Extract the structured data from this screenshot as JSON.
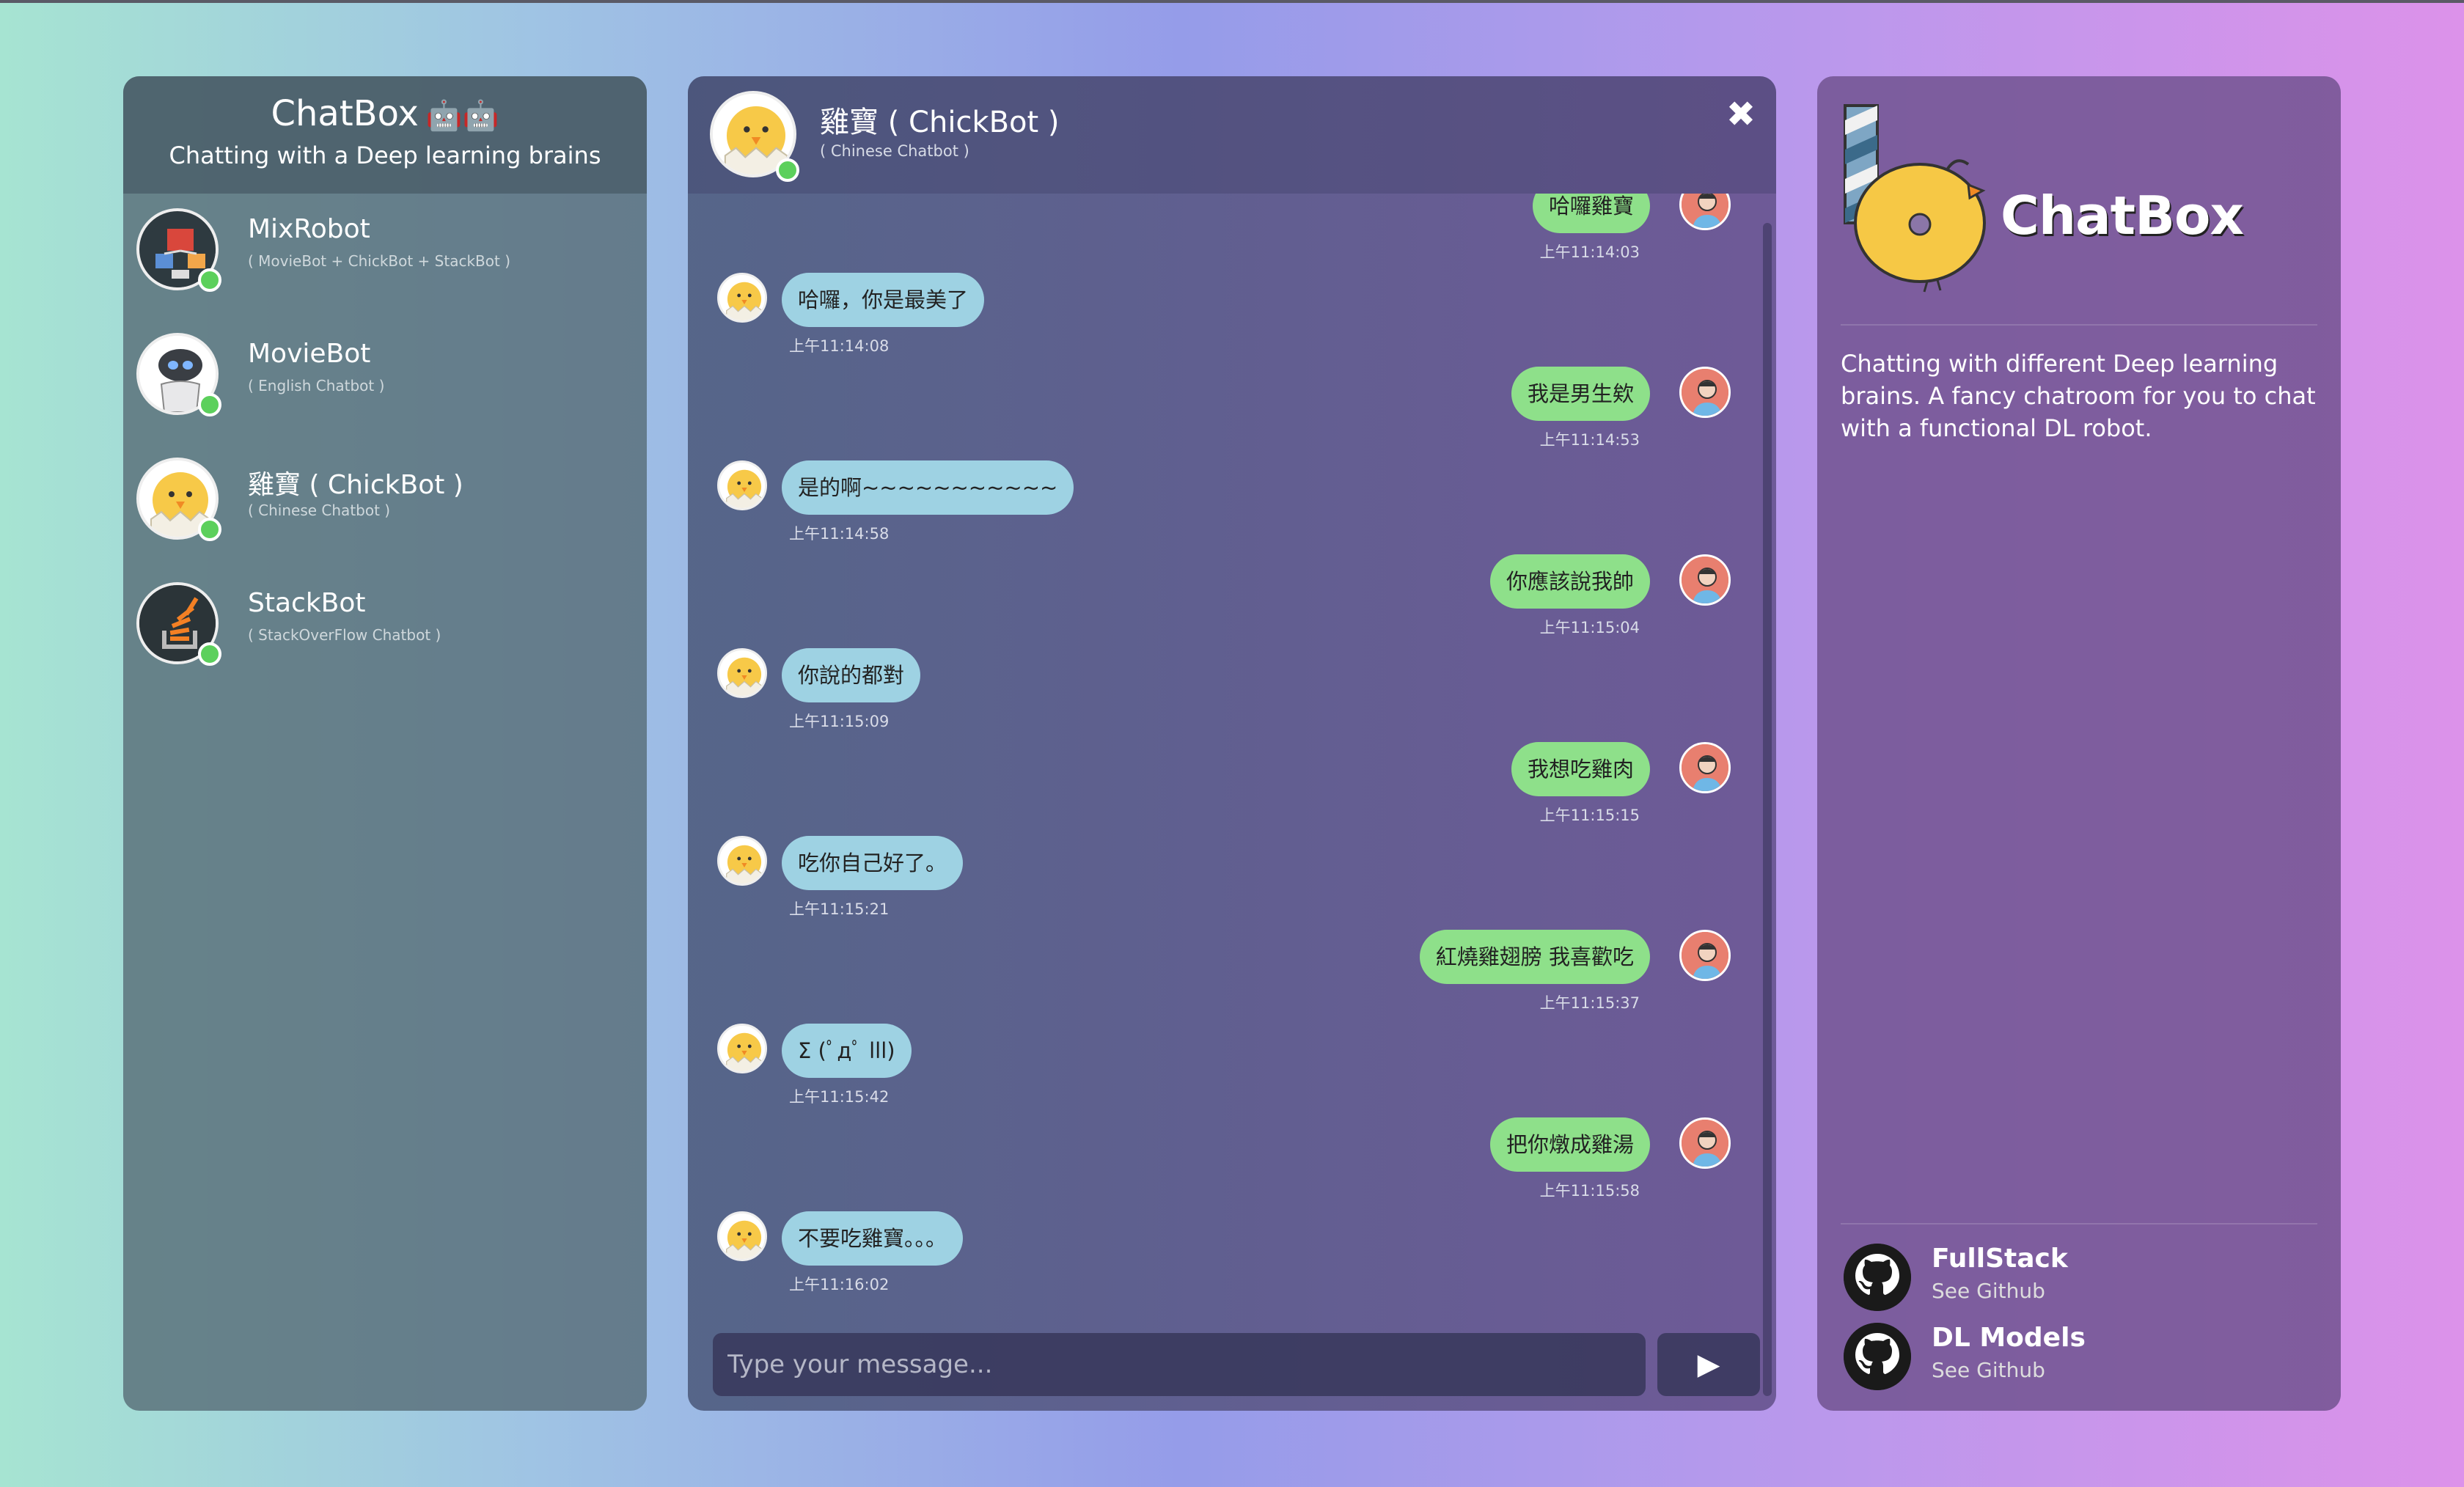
{
  "sidebar": {
    "title": "ChatBox",
    "title_icons": "🤖🤖",
    "subtitle": "Chatting with a Deep learning brains",
    "contacts": [
      {
        "name": "MixRobot",
        "desc": "( MovieBot + ChickBot + StackBot )"
      },
      {
        "name": "MovieBot",
        "desc": "( English Chatbot )"
      },
      {
        "name": "雞寶 ( ChickBot )",
        "desc": "( Chinese Chatbot )"
      },
      {
        "name": "StackBot",
        "desc": "( StackOverFlow Chatbot )"
      }
    ]
  },
  "chat": {
    "name": "雞寶 ( ChickBot )",
    "desc": "( Chinese Chatbot )",
    "close_icon": "✖",
    "messages": [
      {
        "from": "user",
        "text": "哈囉雞寶",
        "time": "上午11:14:03"
      },
      {
        "from": "bot",
        "text": "哈囉，你是最美了",
        "time": "上午11:14:08"
      },
      {
        "from": "user",
        "text": "我是男生欸",
        "time": "上午11:14:53"
      },
      {
        "from": "bot",
        "text": "是的啊~~~~~~~~~~~",
        "time": "上午11:14:58"
      },
      {
        "from": "user",
        "text": "你應該說我帥",
        "time": "上午11:15:04"
      },
      {
        "from": "bot",
        "text": "你說的都對",
        "time": "上午11:15:09"
      },
      {
        "from": "user",
        "text": "我想吃雞肉",
        "time": "上午11:15:15"
      },
      {
        "from": "bot",
        "text": "吃你自己好了。",
        "time": "上午11:15:21"
      },
      {
        "from": "user",
        "text": "紅燒雞翅膀 我喜歡吃",
        "time": "上午11:15:37"
      },
      {
        "from": "bot",
        "text": "Σ (ﾟдﾟ lll)",
        "time": "上午11:15:42"
      },
      {
        "from": "user",
        "text": "把你燉成雞湯",
        "time": "上午11:15:58"
      },
      {
        "from": "bot",
        "text": "不要吃雞寶。。。",
        "time": "上午11:16:02"
      }
    ],
    "input_placeholder": "Type your message...",
    "send_icon": "▶"
  },
  "info": {
    "brand": "ChatBox",
    "about": "Chatting with different Deep learning brains. A fancy chatroom for you to chat with a functional DL robot.",
    "links": [
      {
        "title": "FullStack",
        "sub": "See Github"
      },
      {
        "title": "DL Models",
        "sub": "See Github"
      }
    ]
  }
}
